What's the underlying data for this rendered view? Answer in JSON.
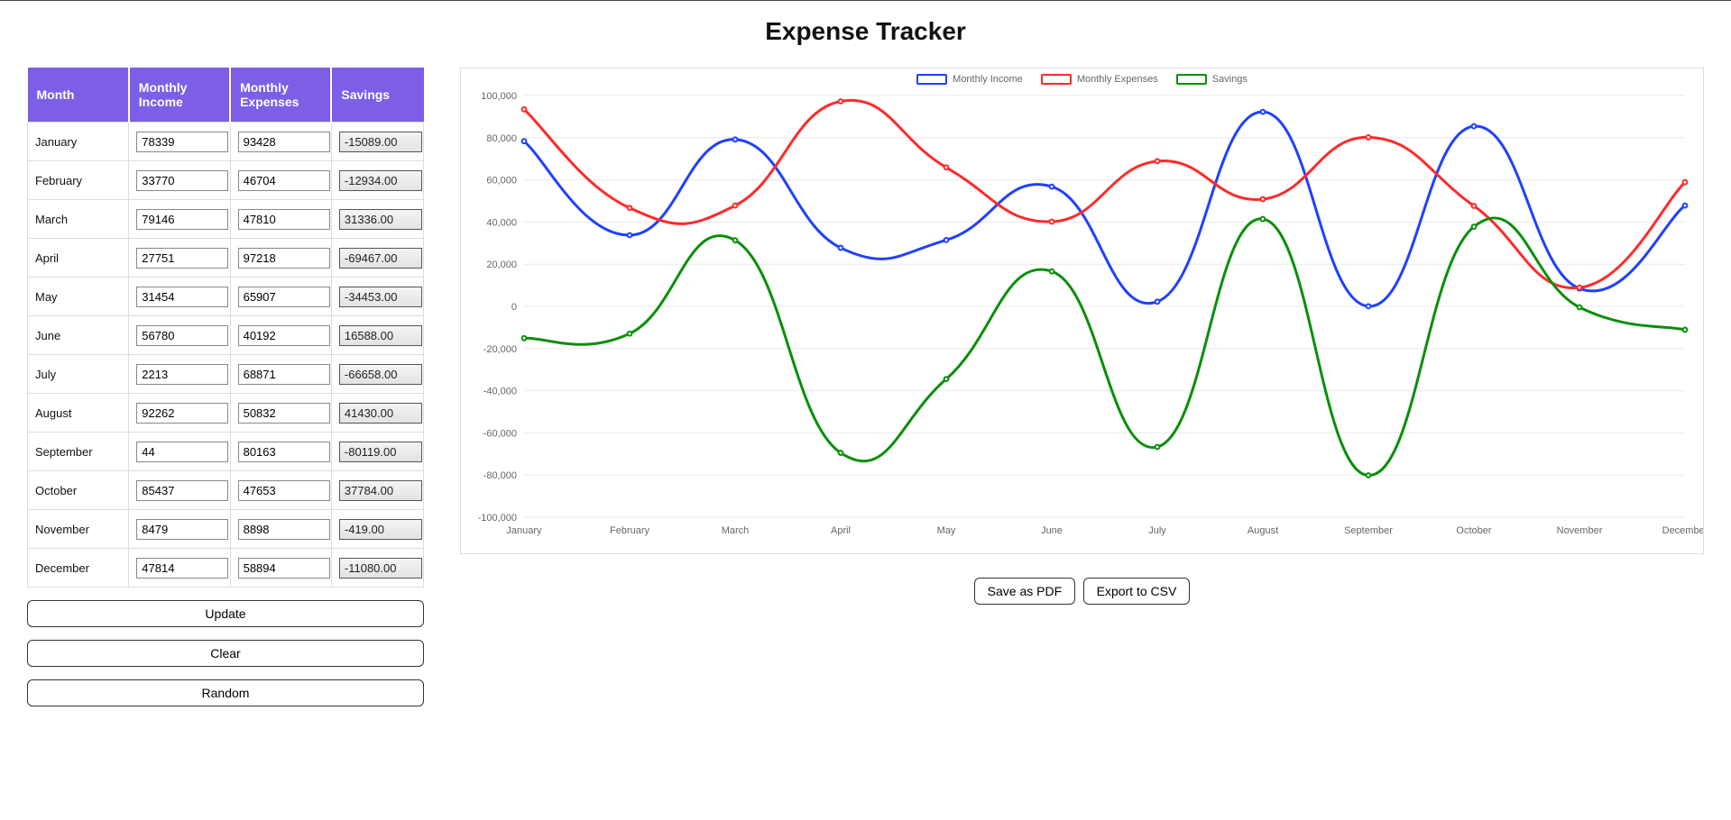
{
  "title": "Expense Tracker",
  "table": {
    "headers": {
      "month": "Month",
      "income": "Monthly Income",
      "expenses": "Monthly Expenses",
      "savings": "Savings"
    },
    "rows": [
      {
        "month": "January",
        "income": "78339",
        "expenses": "93428",
        "savings": "-15089.00"
      },
      {
        "month": "February",
        "income": "33770",
        "expenses": "46704",
        "savings": "-12934.00"
      },
      {
        "month": "March",
        "income": "79146",
        "expenses": "47810",
        "savings": "31336.00"
      },
      {
        "month": "April",
        "income": "27751",
        "expenses": "97218",
        "savings": "-69467.00"
      },
      {
        "month": "May",
        "income": "31454",
        "expenses": "65907",
        "savings": "-34453.00"
      },
      {
        "month": "June",
        "income": "56780",
        "expenses": "40192",
        "savings": "16588.00"
      },
      {
        "month": "July",
        "income": "2213",
        "expenses": "68871",
        "savings": "-66658.00"
      },
      {
        "month": "August",
        "income": "92262",
        "expenses": "50832",
        "savings": "41430.00"
      },
      {
        "month": "September",
        "income": "44",
        "expenses": "80163",
        "savings": "-80119.00"
      },
      {
        "month": "October",
        "income": "85437",
        "expenses": "47653",
        "savings": "37784.00"
      },
      {
        "month": "November",
        "income": "8479",
        "expenses": "8898",
        "savings": "-419.00"
      },
      {
        "month": "December",
        "income": "47814",
        "expenses": "58894",
        "savings": "-11080.00"
      }
    ]
  },
  "buttons": {
    "update": "Update",
    "clear": "Clear",
    "random": "Random",
    "save_pdf": "Save as PDF",
    "export_csv": "Export to CSV"
  },
  "legend": {
    "income": "Monthly Income",
    "expenses": "Monthly Expenses",
    "savings": "Savings"
  },
  "chart_data": {
    "type": "line",
    "categories": [
      "January",
      "February",
      "March",
      "April",
      "May",
      "June",
      "July",
      "August",
      "September",
      "October",
      "November",
      "December"
    ],
    "series": [
      {
        "name": "Monthly Income",
        "color": "#2040ff",
        "values": [
          78339,
          33770,
          79146,
          27751,
          31454,
          56780,
          2213,
          92262,
          44,
          85437,
          8479,
          47814
        ]
      },
      {
        "name": "Monthly Expenses",
        "color": "#ff2a2a",
        "values": [
          93428,
          46704,
          47810,
          97218,
          65907,
          40192,
          68871,
          50832,
          80163,
          47653,
          8898,
          58894
        ]
      },
      {
        "name": "Savings",
        "color": "#0a8f0a",
        "values": [
          -15089,
          -12934,
          31336,
          -69467,
          -34453,
          16588,
          -66658,
          41430,
          -80119,
          37784,
          -419,
          -11080
        ]
      }
    ],
    "ylim": [
      -100000,
      100000
    ],
    "ystep": 20000,
    "xlabel": "",
    "ylabel": "",
    "title": ""
  }
}
